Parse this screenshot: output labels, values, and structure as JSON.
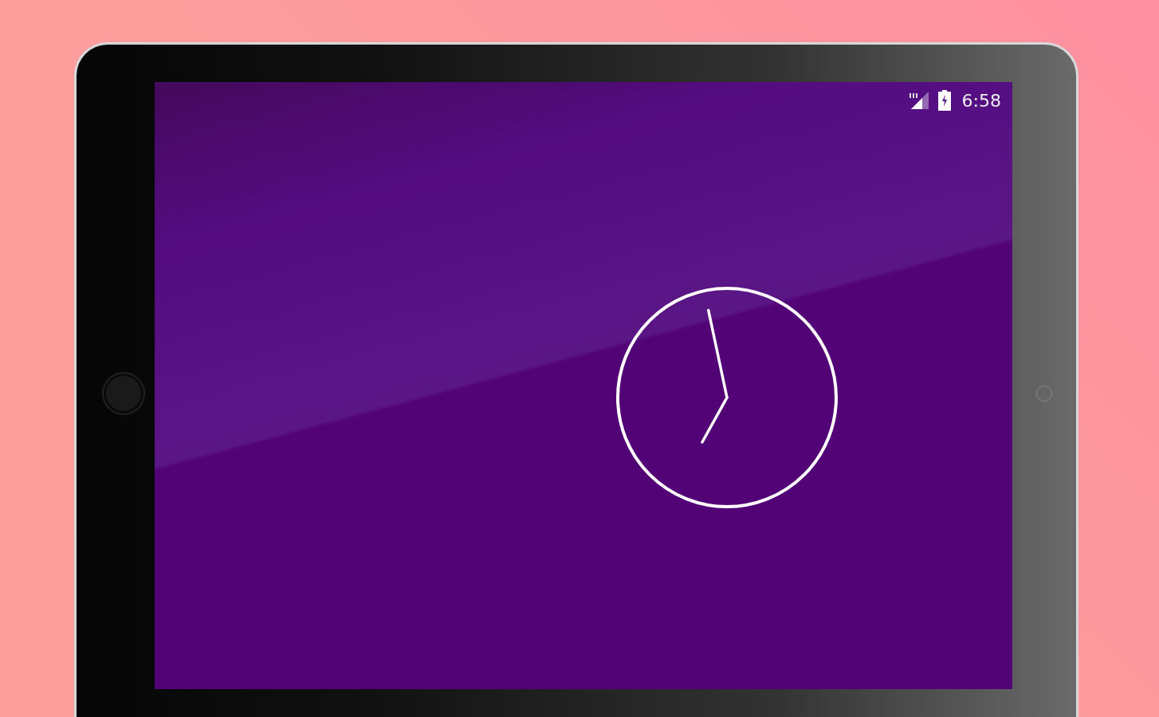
{
  "status_bar": {
    "time": "6:58"
  }
}
